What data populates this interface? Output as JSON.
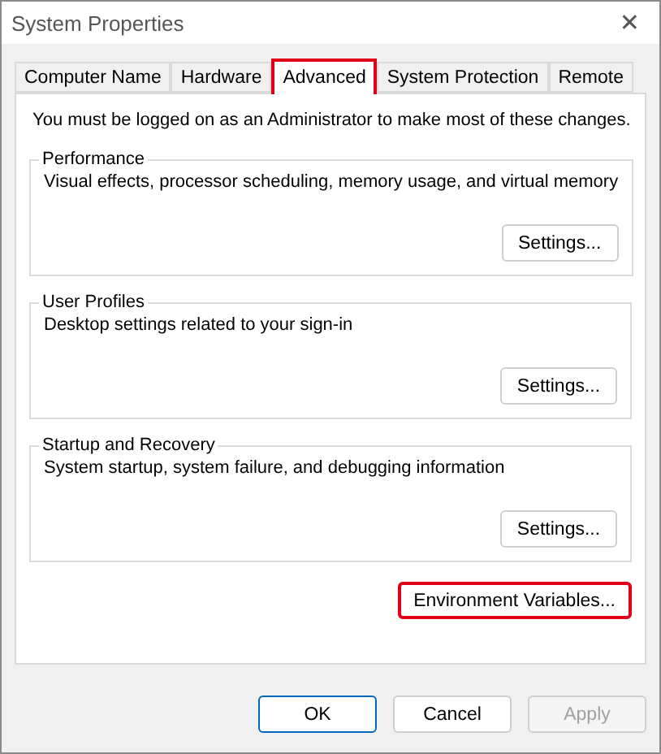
{
  "window": {
    "title": "System Properties",
    "close": "✕"
  },
  "tabs": [
    {
      "label": "Computer Name",
      "selected": false,
      "highlighted": false
    },
    {
      "label": "Hardware",
      "selected": false,
      "highlighted": false
    },
    {
      "label": "Advanced",
      "selected": true,
      "highlighted": true
    },
    {
      "label": "System Protection",
      "selected": false,
      "highlighted": false
    },
    {
      "label": "Remote",
      "selected": false,
      "highlighted": false
    }
  ],
  "notice": "You must be logged on as an Administrator to make most of these changes.",
  "groups": [
    {
      "title": "Performance",
      "description": "Visual effects, processor scheduling, memory usage, and virtual memory",
      "button": "Settings..."
    },
    {
      "title": "User Profiles",
      "description": "Desktop settings related to your sign-in",
      "button": "Settings..."
    },
    {
      "title": "Startup and Recovery",
      "description": "System startup, system failure, and debugging information",
      "button": "Settings..."
    }
  ],
  "environment_button": {
    "label": "Environment Variables...",
    "highlighted": true
  },
  "buttons": [
    {
      "label": "OK",
      "disabled": false,
      "default": true
    },
    {
      "label": "Cancel",
      "disabled": false,
      "default": false
    },
    {
      "label": "Apply",
      "disabled": true,
      "default": false
    }
  ]
}
